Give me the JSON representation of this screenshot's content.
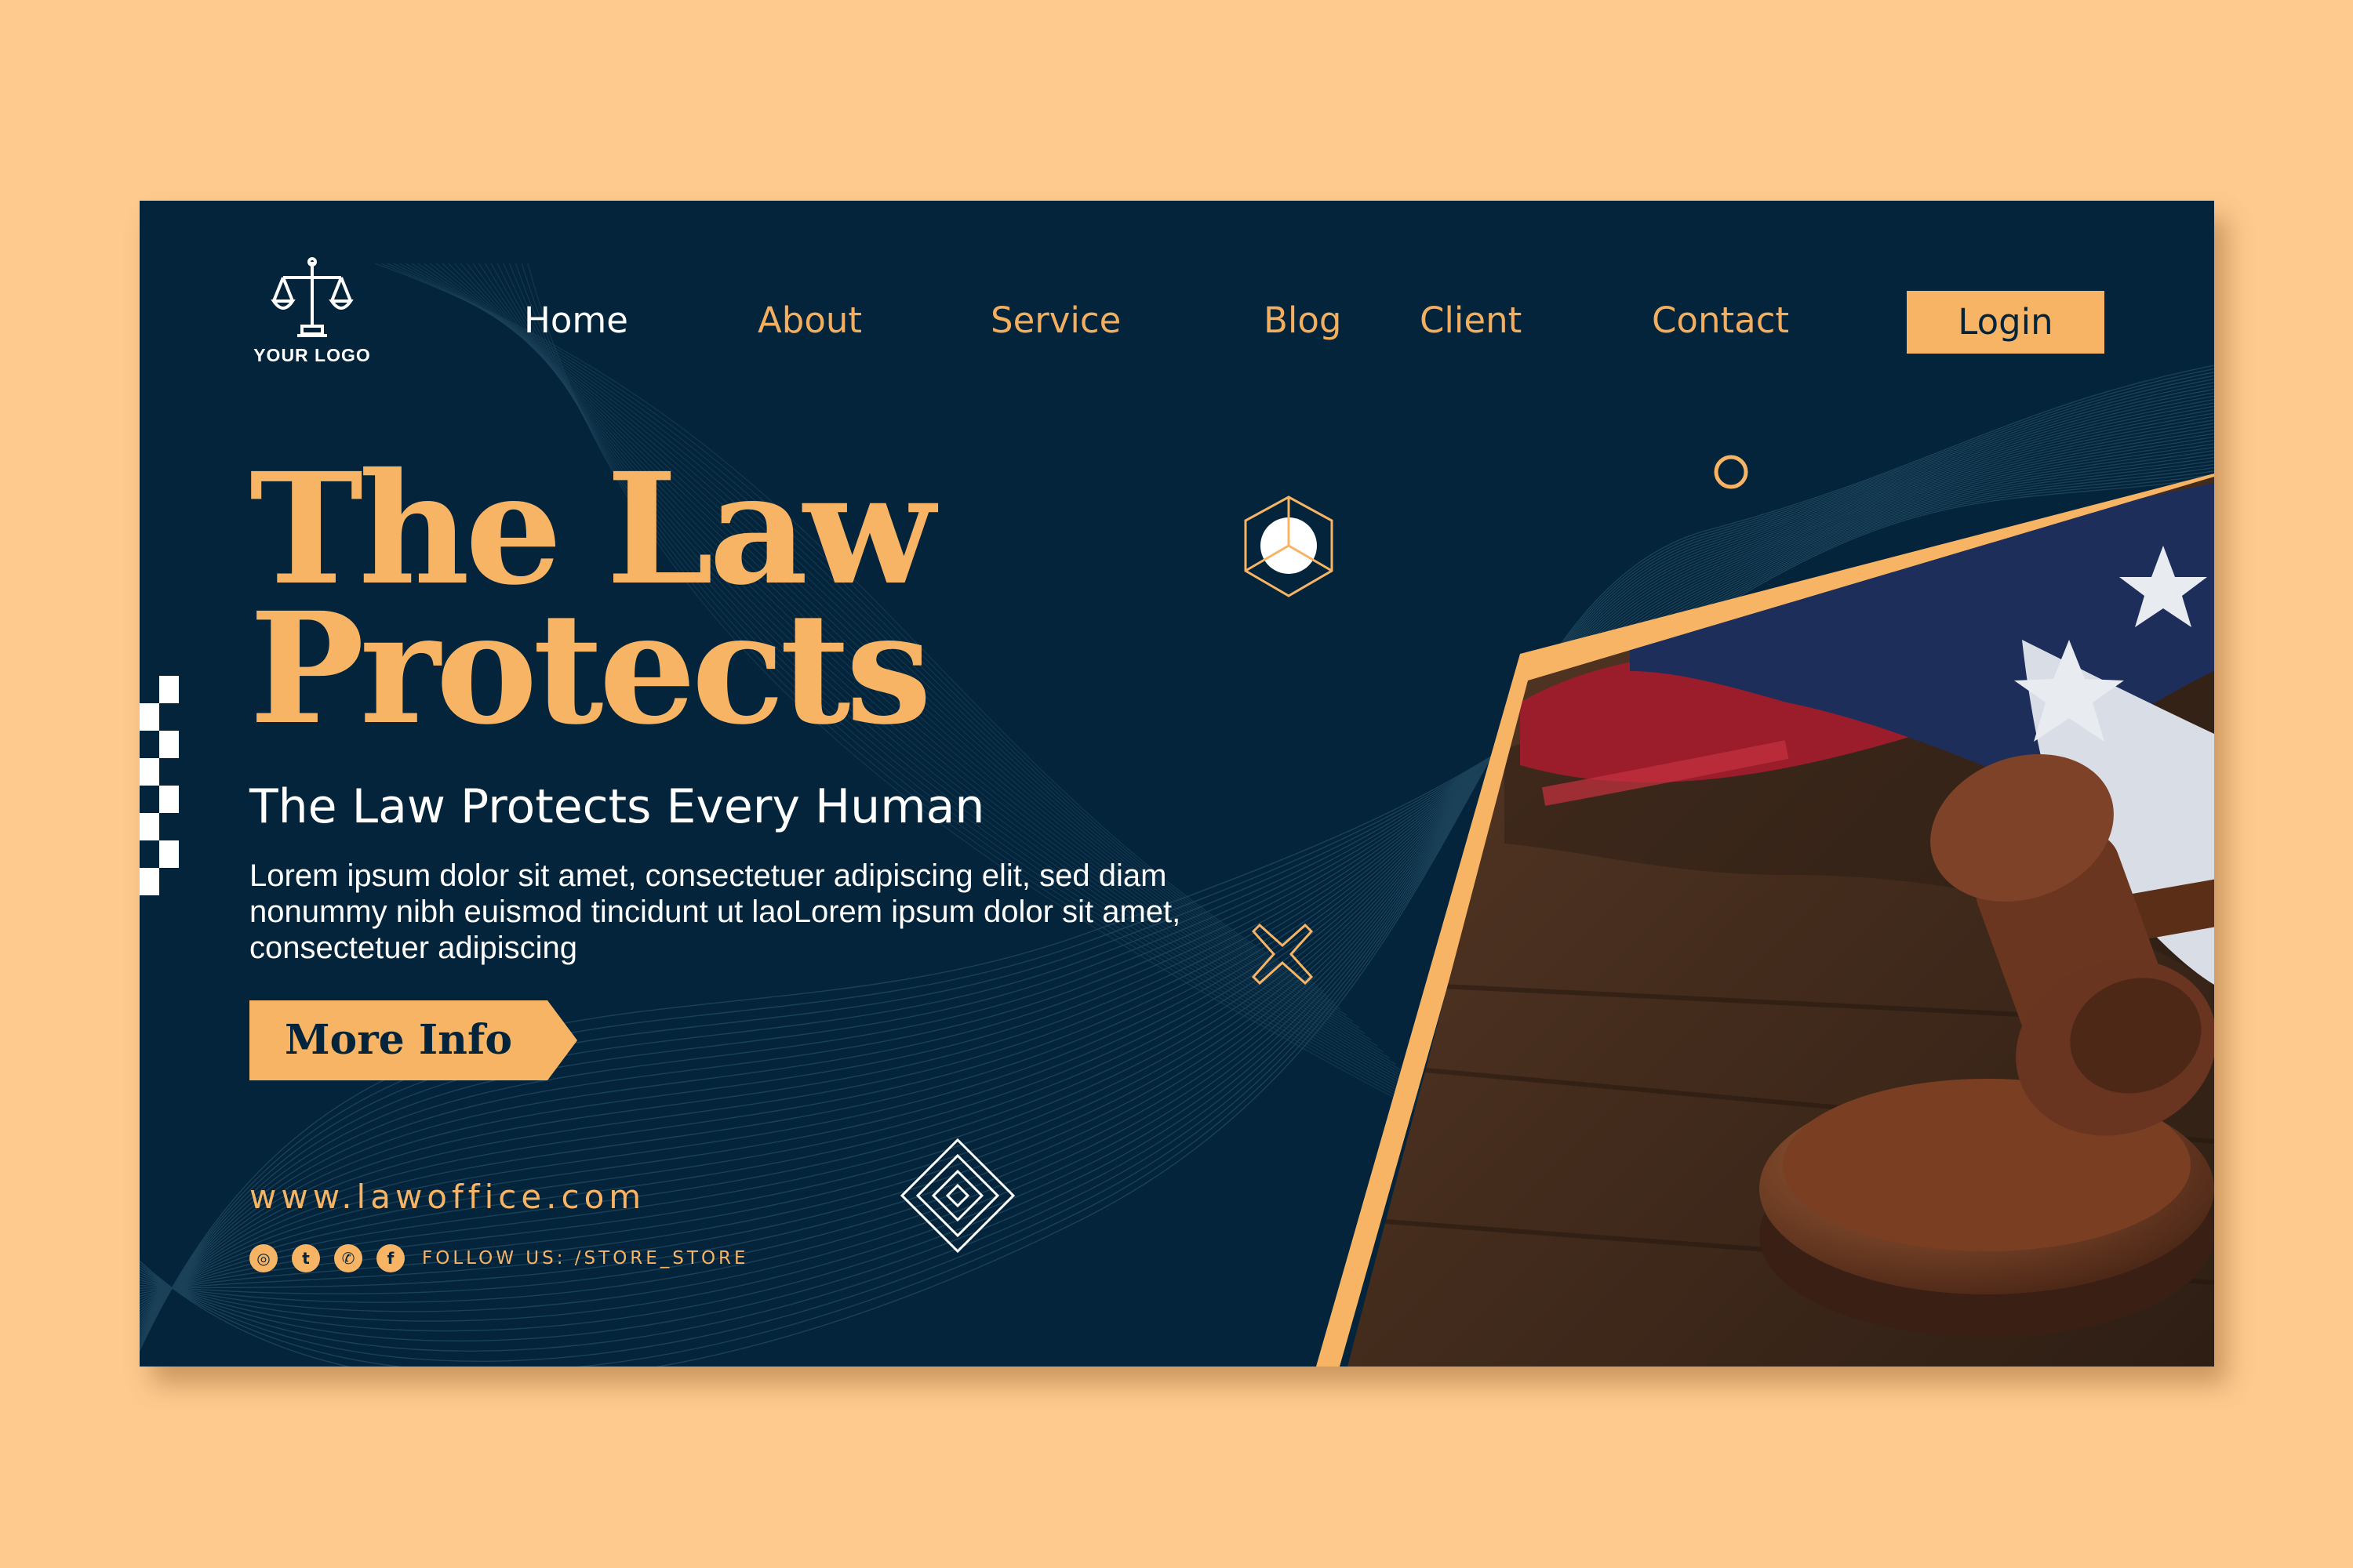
{
  "brand": {
    "logo_text": "YOUR LOGO"
  },
  "nav": {
    "items": [
      {
        "label": "Home",
        "active": true
      },
      {
        "label": "About"
      },
      {
        "label": "Service"
      },
      {
        "label": "Blog"
      },
      {
        "label": "Client"
      },
      {
        "label": "Contact"
      }
    ],
    "login_label": "Login"
  },
  "hero": {
    "title_line1": "The Law",
    "title_line2": "Protects",
    "subtitle": "The Law Protects Every Human",
    "description": "Lorem ipsum dolor sit amet, consectetuer adipiscing elit, sed diam nonummy nibh euismod tincidunt ut laoLorem ipsum dolor sit amet, consectetuer adipiscing",
    "cta_label": "More Info"
  },
  "footer": {
    "website": "www.lawoffice.com",
    "follow_text": "FOLLOW US: /STORE_STORE",
    "social_icons": [
      "instagram-icon",
      "twitter-icon",
      "whatsapp-icon",
      "facebook-icon"
    ]
  },
  "colors": {
    "background": "#FFCA8E",
    "card": "#03243A",
    "accent": "#F8B465",
    "text": "#FFFFFF"
  }
}
